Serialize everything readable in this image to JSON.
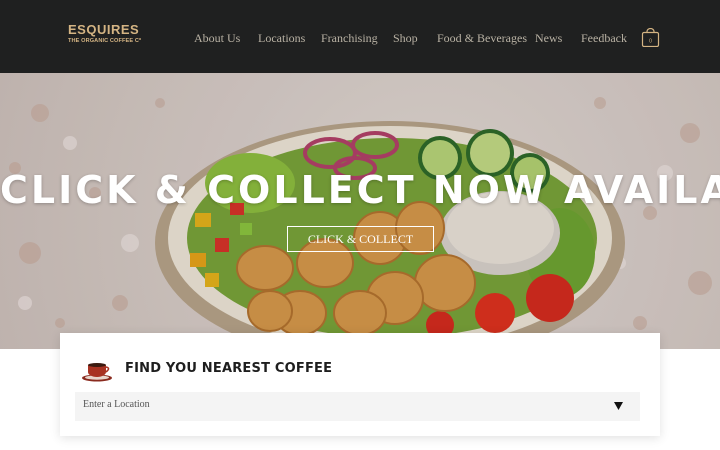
{
  "brand": {
    "name": "ESQUIRES",
    "tagline": "THE ORGANIC COFFEE Cº",
    "color": "#d4b483"
  },
  "nav": {
    "items": [
      {
        "label": "About Us"
      },
      {
        "label": "Locations"
      },
      {
        "label": "Franchising"
      },
      {
        "label": "Shop"
      },
      {
        "label": "Food & Beverages"
      },
      {
        "label": "News"
      },
      {
        "label": "Feedback"
      }
    ],
    "cart_icon": "shopping-bag-icon",
    "cart_count": "0"
  },
  "hero": {
    "title": "CLICK & COLLECT NOW AVAILABLE",
    "button_label": "CLICK & COLLECT"
  },
  "finder": {
    "icon": "coffee-cup-icon",
    "title": "FIND YOU NEAREST COFFEE",
    "select_placeholder": "Enter a Location"
  },
  "colors": {
    "header_bg": "#1f2020",
    "nav_text": "#b9b2a4",
    "accent": "#d4b483"
  }
}
